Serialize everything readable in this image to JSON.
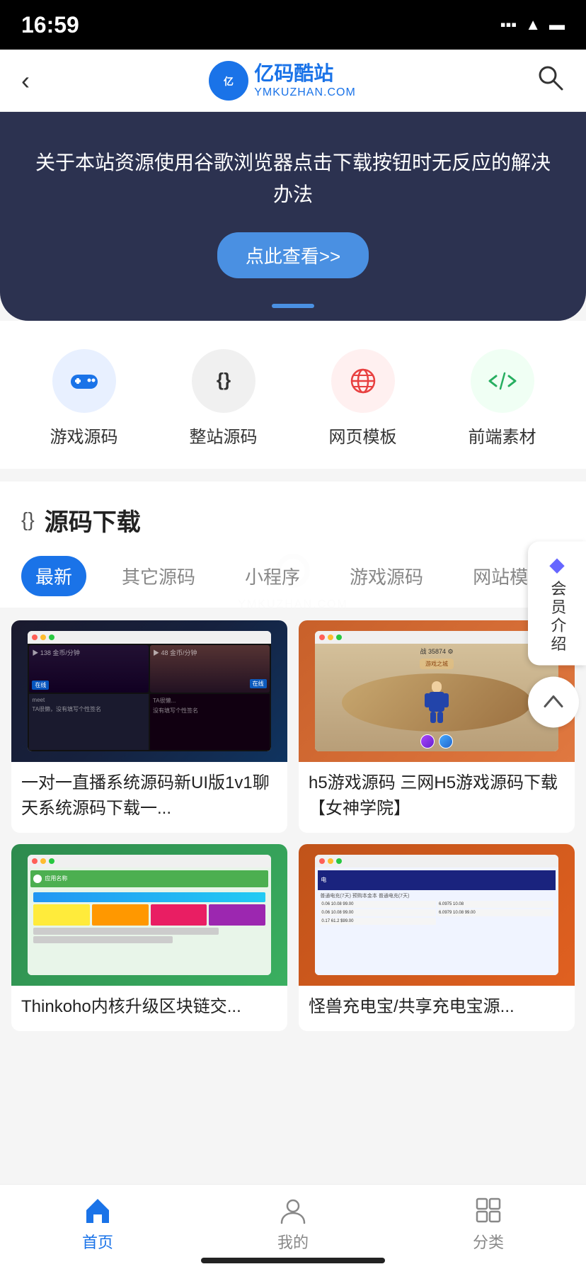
{
  "status": {
    "time": "16:59"
  },
  "header": {
    "back_label": "‹",
    "logo_symbol": "亿码",
    "logo_main": "亿码酷站",
    "logo_sub": "YMKUZHAN.COM",
    "search_label": "🔍"
  },
  "banner": {
    "text": "关于本站资源使用谷歌浏览器点击下载按钮时无反应的解决办法",
    "btn_label": "点此查看>>"
  },
  "categories": [
    {
      "id": "game",
      "icon": "🎮",
      "label": "游戏源码",
      "style": "blue"
    },
    {
      "id": "full",
      "icon": "{}",
      "label": "整站源码",
      "style": "dark"
    },
    {
      "id": "web",
      "icon": "🌐",
      "label": "网页模板",
      "style": "red"
    },
    {
      "id": "frontend",
      "icon": "</>",
      "label": "前端素材",
      "style": "green"
    }
  ],
  "section": {
    "icon": "{}",
    "title": "源码下载"
  },
  "tabs": [
    {
      "id": "latest",
      "label": "最新",
      "active": true
    },
    {
      "id": "other",
      "label": "其它源码",
      "active": false
    },
    {
      "id": "miniapp",
      "label": "小程序",
      "active": false
    },
    {
      "id": "game",
      "label": "游戏源码",
      "active": false
    },
    {
      "id": "website",
      "label": "网站模板",
      "active": false
    }
  ],
  "cards": [
    {
      "id": "card1",
      "thumb_type": "thumb-1",
      "title": "一对一直播系统源码新UI版1v1聊天系统源码下载一..."
    },
    {
      "id": "card2",
      "thumb_type": "thumb-2",
      "title": "h5游戏源码 三网H5游戏源码下载 【女神学院】"
    },
    {
      "id": "card3",
      "thumb_type": "thumb-3",
      "title": "Thinkoho内核升级区块链交..."
    },
    {
      "id": "card4",
      "thumb_type": "thumb-4",
      "title": "怪兽充电宝/共享充电宝源..."
    }
  ],
  "floating": {
    "vip_icon": "◆",
    "vip_text": "会员介绍",
    "top_icon": "↑"
  },
  "bottom_nav": [
    {
      "id": "home",
      "icon": "⌂",
      "label": "首页",
      "active": true
    },
    {
      "id": "profile",
      "icon": "👤",
      "label": "我的",
      "active": false
    },
    {
      "id": "category",
      "icon": "⊞",
      "label": "分类",
      "active": false
    }
  ]
}
